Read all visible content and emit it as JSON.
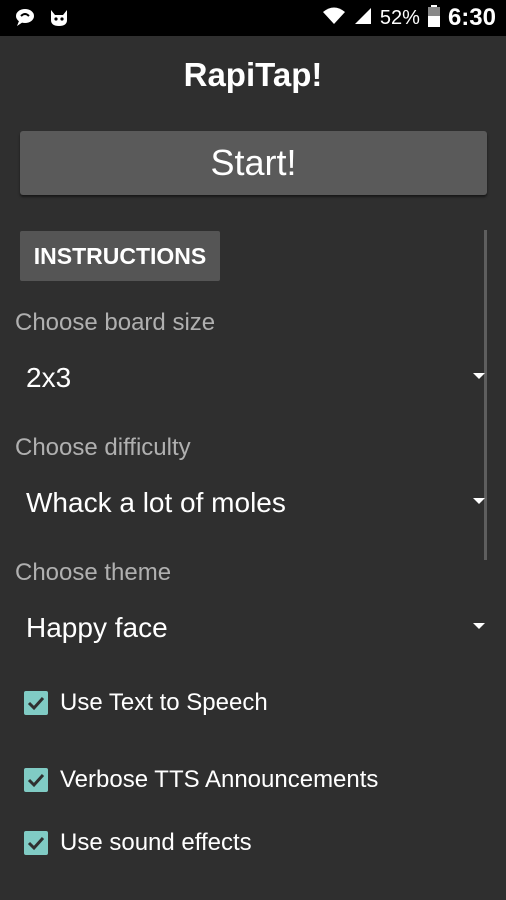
{
  "status_bar": {
    "icons_left": [
      "chat-bubble-icon",
      "cat-face-icon"
    ],
    "icons_right": [
      "wifi-icon",
      "cell-signal-icon",
      "battery-icon"
    ],
    "battery_percent": "52%",
    "time": "6:30"
  },
  "app": {
    "title": "RapiTap!",
    "start_label": "Start!",
    "instructions_label": "INSTRUCTIONS"
  },
  "settings": {
    "board_size_label": "Choose board size",
    "board_size_value": "2x3",
    "difficulty_label": "Choose difficulty",
    "difficulty_value": "Whack a lot of moles",
    "theme_label": "Choose theme",
    "theme_value": "Happy face"
  },
  "checkboxes": [
    {
      "label": "Use Text to Speech",
      "checked": true
    },
    {
      "label": "Verbose TTS Announcements",
      "checked": true
    },
    {
      "label": "Use sound effects",
      "checked": true
    }
  ],
  "colors": {
    "background": "#2f2f2f",
    "status_bar": "#000000",
    "button": "#5a5a5a",
    "label_gray": "#b0b0b0",
    "accent_teal": "#80cbc4"
  }
}
